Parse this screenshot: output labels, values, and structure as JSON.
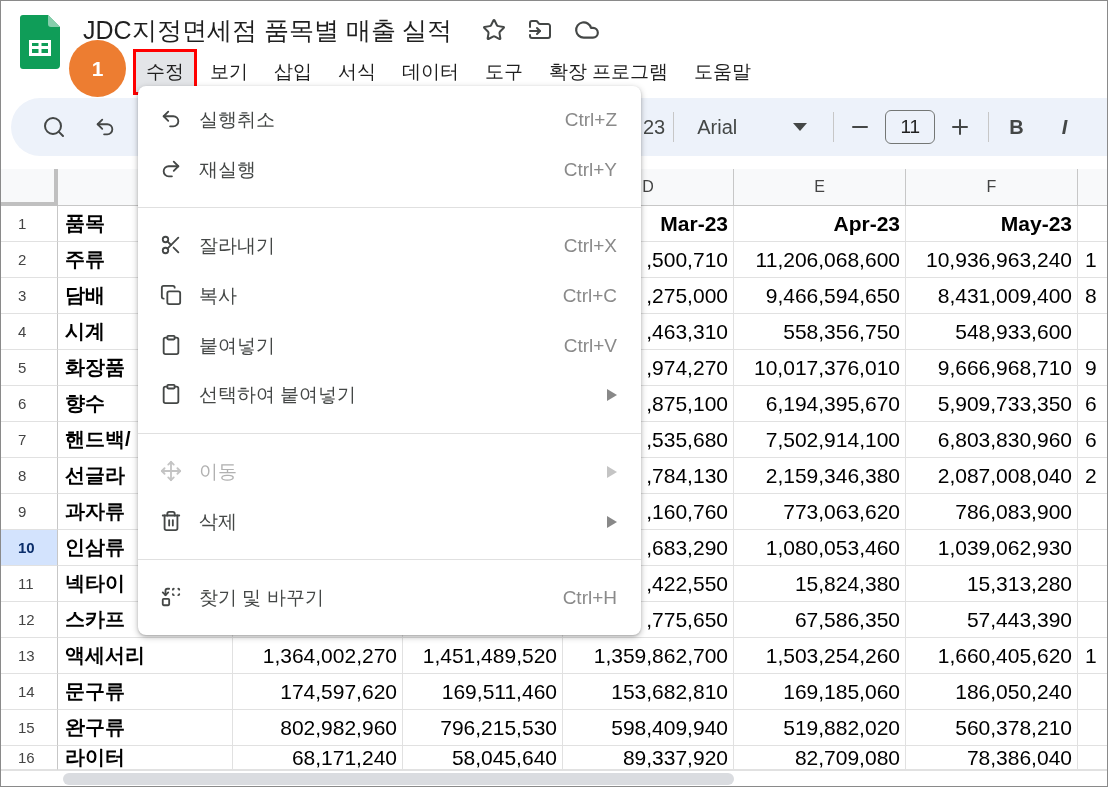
{
  "document_title": "JDC지정면세점 품목별 매출 실적",
  "step_badge": "1",
  "menu_bar": [
    {
      "label": "수정",
      "selected": true
    },
    {
      "label": "보기",
      "selected": false
    },
    {
      "label": "삽입",
      "selected": false
    },
    {
      "label": "서식",
      "selected": false
    },
    {
      "label": "데이터",
      "selected": false
    },
    {
      "label": "도구",
      "selected": false
    },
    {
      "label": "확장 프로그램",
      "selected": false
    },
    {
      "label": "도움말",
      "selected": false
    }
  ],
  "toolbar": {
    "number_format": "23",
    "font": "Arial",
    "font_size": "11",
    "bold_button": "B",
    "italic_button": "I"
  },
  "edit_menu": {
    "groups": [
      {
        "items": [
          {
            "label": "실행취소",
            "shortcut": "Ctrl+Z",
            "kind": "action",
            "disabled": false
          },
          {
            "label": "재실행",
            "shortcut": "Ctrl+Y",
            "kind": "action",
            "disabled": false
          }
        ]
      },
      {
        "items": [
          {
            "label": "잘라내기",
            "shortcut": "Ctrl+X",
            "kind": "action",
            "disabled": false
          },
          {
            "label": "복사",
            "shortcut": "Ctrl+C",
            "kind": "action",
            "disabled": false
          },
          {
            "label": "붙여넣기",
            "shortcut": "Ctrl+V",
            "kind": "action",
            "disabled": false
          },
          {
            "label": "선택하여 붙여넣기",
            "kind": "submenu",
            "disabled": false
          }
        ]
      },
      {
        "items": [
          {
            "label": "이동",
            "kind": "submenu",
            "disabled": true
          },
          {
            "label": "삭제",
            "kind": "submenu",
            "disabled": false
          }
        ]
      },
      {
        "items": [
          {
            "label": "찾기 및 바꾸기",
            "shortcut": "Ctrl+H",
            "kind": "action",
            "disabled": false
          }
        ]
      }
    ]
  },
  "column_headers": {
    "D": "D",
    "E": "E",
    "F": "F"
  },
  "rows": [
    {
      "number": "1",
      "selected": false,
      "kind": "header",
      "cells": {
        "A": "품목",
        "D": "Mar-23",
        "E": "Apr-23",
        "F": "May-23"
      }
    },
    {
      "number": "2",
      "selected": false,
      "kind": "data",
      "cells": {
        "A": "주류",
        "D": ",500,710",
        "E": "11,206,068,600",
        "F": "10,936,963,240",
        "G": "1"
      }
    },
    {
      "number": "3",
      "selected": false,
      "kind": "data",
      "cells": {
        "A": "담배",
        "D": ",275,000",
        "E": "9,466,594,650",
        "F": "8,431,009,400",
        "G": "8"
      }
    },
    {
      "number": "4",
      "selected": false,
      "kind": "data",
      "cells": {
        "A": "시계",
        "D": ",463,310",
        "E": "558,356,750",
        "F": "548,933,600"
      }
    },
    {
      "number": "5",
      "selected": false,
      "kind": "data",
      "cells": {
        "A": "화장품",
        "D": ",974,270",
        "E": "10,017,376,010",
        "F": "9,666,968,710",
        "G": "9"
      }
    },
    {
      "number": "6",
      "selected": false,
      "kind": "data",
      "cells": {
        "A": "향수",
        "D": ",875,100",
        "E": "6,194,395,670",
        "F": "5,909,733,350",
        "G": "6"
      }
    },
    {
      "number": "7",
      "selected": false,
      "kind": "data",
      "cells": {
        "A": "핸드백/",
        "D": ",535,680",
        "E": "7,502,914,100",
        "F": "6,803,830,960",
        "G": "6"
      }
    },
    {
      "number": "8",
      "selected": false,
      "kind": "data",
      "cells": {
        "A": "선글라",
        "D": ",784,130",
        "E": "2,159,346,380",
        "F": "2,087,008,040",
        "G": "2"
      }
    },
    {
      "number": "9",
      "selected": false,
      "kind": "data",
      "cells": {
        "A": "과자류",
        "D": ",160,760",
        "E": "773,063,620",
        "F": "786,083,900"
      }
    },
    {
      "number": "10",
      "selected": true,
      "kind": "data",
      "cells": {
        "A": "인삼류",
        "D": ",683,290",
        "E": "1,080,053,460",
        "F": "1,039,062,930"
      }
    },
    {
      "number": "11",
      "selected": false,
      "kind": "data",
      "cells": {
        "A": "넥타이",
        "D": ",422,550",
        "E": "15,824,380",
        "F": "15,313,280"
      }
    },
    {
      "number": "12",
      "selected": false,
      "kind": "data",
      "cells": {
        "A": "스카프",
        "D": ",775,650",
        "E": "67,586,350",
        "F": "57,443,390"
      }
    },
    {
      "number": "13",
      "selected": false,
      "kind": "data",
      "cells": {
        "A": "액세서리",
        "B": "1,364,002,270",
        "C": "1,451,489,520",
        "D": "1,359,862,700",
        "E": "1,503,254,260",
        "F": "1,660,405,620",
        "G": "1"
      }
    },
    {
      "number": "14",
      "selected": false,
      "kind": "data",
      "cells": {
        "A": "문구류",
        "B": "174,597,620",
        "C": "169,511,460",
        "D": "153,682,810",
        "E": "169,185,060",
        "F": "186,050,240"
      }
    },
    {
      "number": "15",
      "selected": false,
      "kind": "data",
      "cells": {
        "A": "완구류",
        "B": "802,982,960",
        "C": "796,215,530",
        "D": "598,409,940",
        "E": "519,882,020",
        "F": "560,378,210"
      }
    },
    {
      "number": "16",
      "selected": false,
      "kind": "data",
      "cells": {
        "A": "라이터",
        "B": "68,171,240",
        "C": "58,045,640",
        "D": "89,337,920",
        "E": "82,709,080",
        "F": "78,386,040"
      }
    }
  ]
}
